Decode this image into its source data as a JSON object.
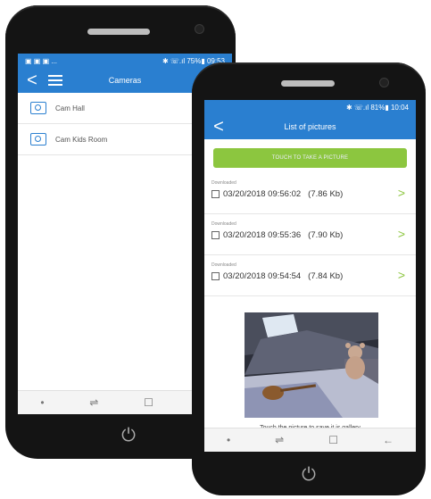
{
  "back_phone": {
    "status": {
      "left_icons": "▣ ▣ ▣ ...",
      "right": "✱ ☏.ıl 75%▮ 09:53"
    },
    "appbar": {
      "back_icon": "<",
      "title": "Cameras"
    },
    "cameras": [
      {
        "label": "Cam Hall"
      },
      {
        "label": "Cam Kids Room"
      }
    ],
    "nav": {
      "dot": "•",
      "recent": "⇌",
      "home": "☐",
      "back": "←"
    },
    "power_icon": "⏻"
  },
  "front_phone": {
    "status": {
      "right": "✱ ☏.ıl 81%▮ 10:04"
    },
    "appbar": {
      "back_icon": "<",
      "title": "List of pictures"
    },
    "take_picture_label": "TOUCH TO TAKE A PICTURE",
    "pictures": [
      {
        "status": "Downloaded",
        "datetime": "03/20/2018 09:56:02",
        "size": "(7.86 Kb)"
      },
      {
        "status": "Downloaded",
        "datetime": "03/20/2018 09:55:36",
        "size": "(7.90 Kb)"
      },
      {
        "status": "Downloaded",
        "datetime": "03/20/2018 09:54:54",
        "size": "(7.84 Kb)"
      }
    ],
    "chevron": ">",
    "caption": "Touch the picture to save it is gallery",
    "nav": {
      "dot": "•",
      "recent": "⇌",
      "home": "☐",
      "back": "←"
    },
    "power_icon": "⏻"
  },
  "colors": {
    "blue": "#2a7fd0",
    "green": "#8cc63f",
    "phone_body": "#141414"
  }
}
